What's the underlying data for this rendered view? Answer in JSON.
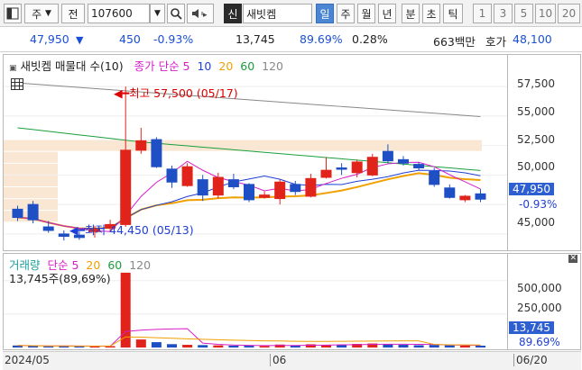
{
  "toolbar": {
    "period_label": "주",
    "jeon_label": "전",
    "code_value": "107600",
    "shin_badge": "신",
    "stock_name": "새빗켐",
    "period_tabs": [
      "일",
      "주",
      "월",
      "년",
      "분",
      "초",
      "틱"
    ],
    "numbers": [
      "1",
      "3",
      "5",
      "10",
      "20"
    ]
  },
  "info": {
    "price": "47,950",
    "change": "450",
    "change_pct": "-0.93%",
    "volume": "13,745",
    "volume_ratio": "89.69%",
    "turnover": "0.28%",
    "amount": "663백만",
    "quote_label": "호가",
    "quote_value": "48,100"
  },
  "price_chart": {
    "title": "새빗켐 매물대 수(10)",
    "ma_label": "종가 단순 5",
    "ma_periods": [
      "10",
      "20",
      "60",
      "120"
    ],
    "high_annotation": "최고 57,500 (05/17)",
    "low_annotation": "최저 44,450 (05/13)",
    "current_tag": "47,950",
    "current_pct": "-0.93%",
    "axis_labels": [
      "57,500",
      "55,000",
      "52,500",
      "50,000",
      "45,000"
    ]
  },
  "volume_chart": {
    "title": "거래량",
    "ma_label": "단순 5",
    "ma_periods": [
      "20",
      "60",
      "120"
    ],
    "info": "13,745주(89,69%)",
    "axis_labels": [
      "500,000",
      "250,000"
    ],
    "current_tag": "13,745",
    "current_pct": "89.69%"
  },
  "date_axis": [
    "2024/05",
    "06",
    "06/20"
  ],
  "colors": {
    "up": "#e0241b",
    "down": "#1f4fc4",
    "ma5": "#d61fc8",
    "ma10": "#1f3fd6",
    "ma20": "#f0a000",
    "ma60": "#1a9e3c",
    "ma120": "#888888"
  },
  "chart_data": {
    "type": "candlestick",
    "title": "새빗켐 매물대 수(10)",
    "price_range": [
      44000,
      58500
    ],
    "candles": [
      {
        "o": 47100,
        "h": 47400,
        "l": 46100,
        "c": 46400,
        "vol": 15000
      },
      {
        "o": 47500,
        "h": 47800,
        "l": 45900,
        "c": 46200,
        "vol": 12000
      },
      {
        "o": 45600,
        "h": 46100,
        "l": 45100,
        "c": 45300,
        "vol": 9000
      },
      {
        "o": 45000,
        "h": 45300,
        "l": 44450,
        "c": 44800,
        "vol": 11000
      },
      {
        "o": 44900,
        "h": 45200,
        "l": 44500,
        "c": 44700,
        "vol": 9000
      },
      {
        "o": 45200,
        "h": 45700,
        "l": 44700,
        "c": 45400,
        "vol": 8000
      },
      {
        "o": 45500,
        "h": 46200,
        "l": 45200,
        "c": 45800,
        "vol": 10000
      },
      {
        "o": 45800,
        "h": 57500,
        "l": 45600,
        "c": 52100,
        "vol": 560000
      },
      {
        "o": 52100,
        "h": 54000,
        "l": 51800,
        "c": 52900,
        "vol": 60000
      },
      {
        "o": 53000,
        "h": 53200,
        "l": 50600,
        "c": 50700,
        "vol": 40000
      },
      {
        "o": 50500,
        "h": 50800,
        "l": 48900,
        "c": 49400,
        "vol": 25000
      },
      {
        "o": 49100,
        "h": 51000,
        "l": 49000,
        "c": 50700,
        "vol": 20000
      },
      {
        "o": 49600,
        "h": 50000,
        "l": 47800,
        "c": 48300,
        "vol": 18000
      },
      {
        "o": 48300,
        "h": 50200,
        "l": 48000,
        "c": 49800,
        "vol": 16000
      },
      {
        "o": 49600,
        "h": 50100,
        "l": 48800,
        "c": 49000,
        "vol": 14000
      },
      {
        "o": 49200,
        "h": 49300,
        "l": 47700,
        "c": 47900,
        "vol": 13000
      },
      {
        "o": 48100,
        "h": 48600,
        "l": 48000,
        "c": 48300,
        "vol": 11000
      },
      {
        "o": 48000,
        "h": 49600,
        "l": 47500,
        "c": 49400,
        "vol": 22000
      },
      {
        "o": 49200,
        "h": 49500,
        "l": 48300,
        "c": 48600,
        "vol": 15000
      },
      {
        "o": 48200,
        "h": 50100,
        "l": 48100,
        "c": 49700,
        "vol": 24000
      },
      {
        "o": 49800,
        "h": 51500,
        "l": 49700,
        "c": 50400,
        "vol": 18000
      },
      {
        "o": 50600,
        "h": 51000,
        "l": 50000,
        "c": 50500,
        "vol": 21000
      },
      {
        "o": 50200,
        "h": 51300,
        "l": 49800,
        "c": 51100,
        "vol": 27000
      },
      {
        "o": 50000,
        "h": 51800,
        "l": 49900,
        "c": 51500,
        "vol": 30000
      },
      {
        "o": 52000,
        "h": 52600,
        "l": 51000,
        "c": 51200,
        "vol": 26000
      },
      {
        "o": 51300,
        "h": 51600,
        "l": 50800,
        "c": 51000,
        "vol": 20000
      },
      {
        "o": 50900,
        "h": 51100,
        "l": 50400,
        "c": 50600,
        "vol": 17000
      },
      {
        "o": 50300,
        "h": 50600,
        "l": 49000,
        "c": 49200,
        "vol": 19000
      },
      {
        "o": 48900,
        "h": 49200,
        "l": 48000,
        "c": 48100,
        "vol": 16000
      },
      {
        "o": 47900,
        "h": 48300,
        "l": 47700,
        "c": 48200,
        "vol": 14000
      },
      {
        "o": 48400,
        "h": 48800,
        "l": 47700,
        "c": 47950,
        "vol": 13745
      }
    ],
    "volume_range": [
      0,
      620000
    ]
  }
}
